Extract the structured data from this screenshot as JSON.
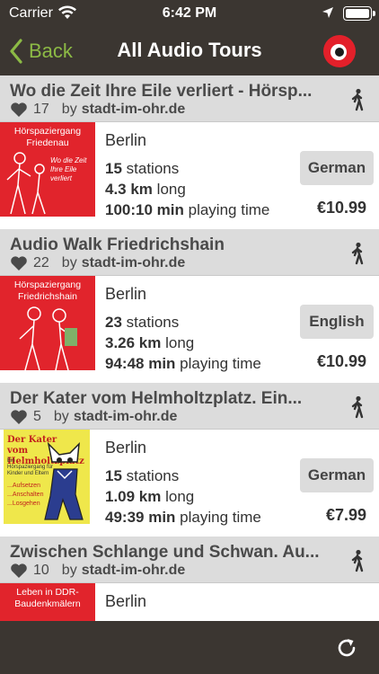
{
  "status": {
    "carrier": "Carrier",
    "time": "6:42 PM"
  },
  "nav": {
    "back_label": "Back",
    "title": "All Audio Tours"
  },
  "tours": [
    {
      "title": "Wo die Zeit Ihre Eile verliert - Hörsp...",
      "likes": "17",
      "by": "by",
      "author": "stadt-im-ohr.de",
      "city": "Berlin",
      "stations": "15",
      "stations_label": "stations",
      "length": "4.3 km",
      "length_label": "long",
      "duration": "100:10 min",
      "duration_label": "playing time",
      "language": "German",
      "price": "€10.99",
      "thumb_caption": "Hörspaziergang Friedenau",
      "thumb_subtitle": "Wo die Zeit Ihre Eile verliert"
    },
    {
      "title": "Audio Walk Friedrichshain",
      "likes": "22",
      "by": "by",
      "author": "stadt-im-ohr.de",
      "city": "Berlin",
      "stations": "23",
      "stations_label": "stations",
      "length": "3.26 km",
      "length_label": "long",
      "duration": "94:48 min",
      "duration_label": "playing time",
      "language": "English",
      "price": "€10.99",
      "thumb_caption": "Hörspaziergang Friedrichshain"
    },
    {
      "title": "Der Kater vom Helmholtzplatz. Ein...",
      "likes": "5",
      "by": "by",
      "author": "stadt-im-ohr.de",
      "city": "Berlin",
      "stations": "15",
      "stations_label": "stations",
      "length": "1.09 km",
      "length_label": "long",
      "duration": "49:39 min",
      "duration_label": "playing time",
      "language": "German",
      "price": "€7.99",
      "thumb_caption": "Der Kater vom Helmholtzplatz",
      "thumb_subtitle": "Ein Hörspaziergang für Kinder und Eltern",
      "thumb_notes": "...Aufsetzen ...Anschalten ...Losgehen"
    },
    {
      "title": "Zwischen Schlange und Schwan. Au...",
      "likes": "10",
      "by": "by",
      "author": "stadt-im-ohr.de",
      "city": "Berlin",
      "thumb_caption": "Leben in DDR-Baudenkmälern"
    }
  ],
  "colors": {
    "bar": "#3b3631",
    "accent_green": "#8cba45",
    "logo_red": "#e3202a",
    "header_gray": "#dcdcdc"
  },
  "icons": {
    "back": "chevron-left-icon",
    "logo": "eye-logo-icon",
    "likes": "heart-icon",
    "mode": "walking-icon",
    "refresh": "refresh-icon"
  }
}
